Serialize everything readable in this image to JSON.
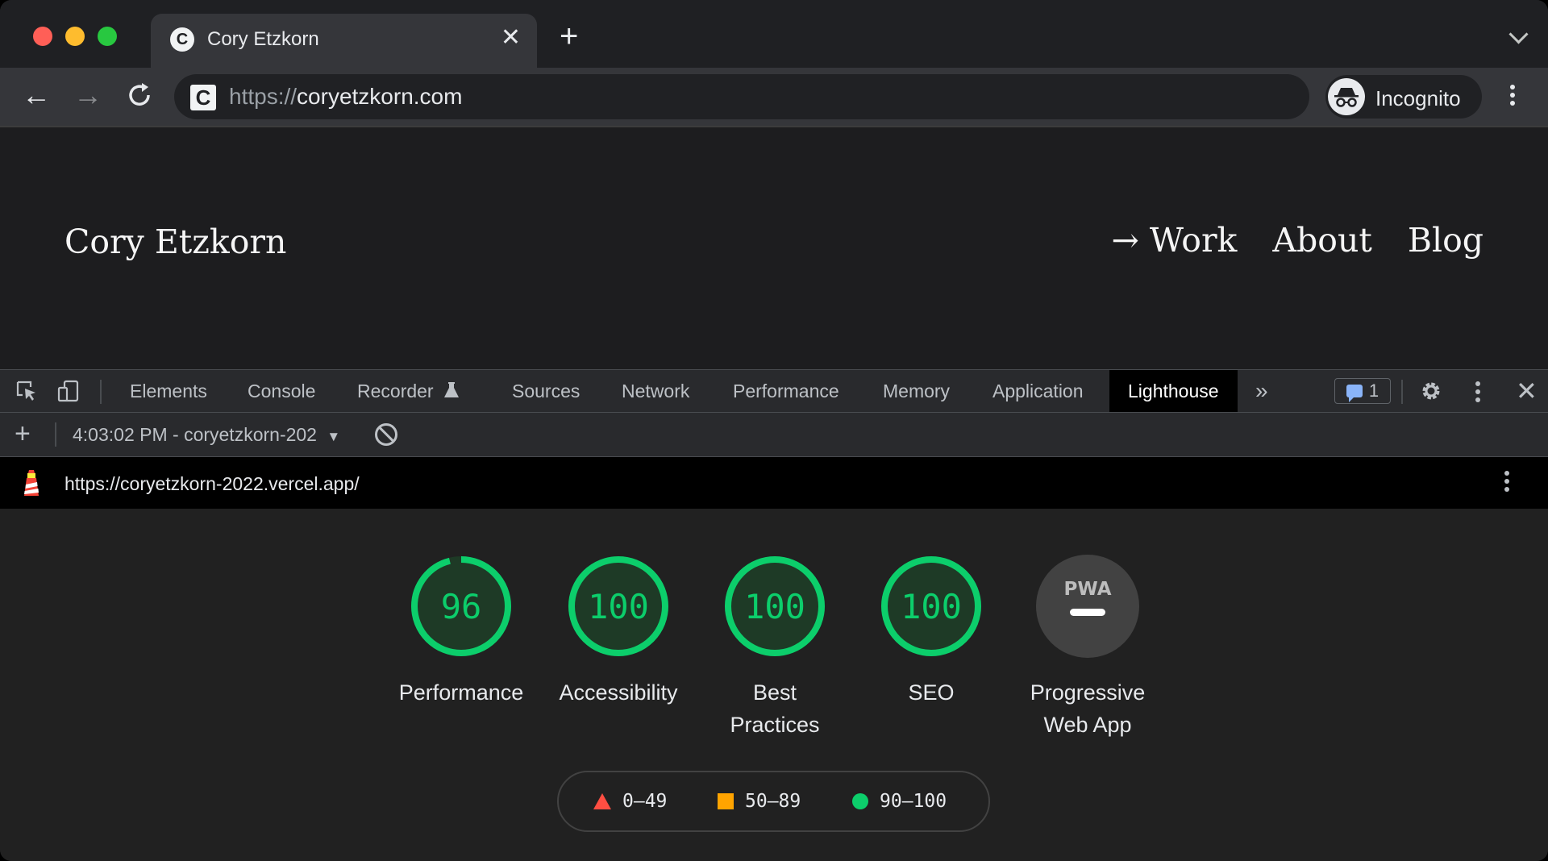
{
  "colors": {
    "pass": "#0cce6b",
    "pass_text": "#0cce6b",
    "average": "#ffa400",
    "fail": "#ff4e42",
    "gauge_bg": "#1e3a26"
  },
  "browser": {
    "tab": {
      "title": "Cory Etzkorn",
      "favicon": "C"
    },
    "address": {
      "scheme": "https://",
      "host": "coryetzkorn.com"
    },
    "incognito_label": "Incognito"
  },
  "page": {
    "site_title": "Cory Etzkorn",
    "nav": {
      "work": "→ Work",
      "about": "About",
      "blog": "Blog"
    }
  },
  "devtools": {
    "tabs": [
      {
        "label": "Elements"
      },
      {
        "label": "Console"
      },
      {
        "label": "Recorder"
      },
      {
        "label": "Sources"
      },
      {
        "label": "Network"
      },
      {
        "label": "Performance"
      },
      {
        "label": "Memory"
      },
      {
        "label": "Application"
      },
      {
        "label": "Lighthouse"
      }
    ],
    "issues_count": "1",
    "report_select": "4:03:02 PM - coryetzkorn-202",
    "report_url": "https://coryetzkorn-2022.vercel.app/"
  },
  "lighthouse": {
    "categories": [
      {
        "label": "Performance",
        "score": "96",
        "value": 96
      },
      {
        "label": "Accessibility",
        "score": "100",
        "value": 100
      },
      {
        "label": "Best\nPractices",
        "score": "100",
        "value": 100
      },
      {
        "label": "SEO",
        "score": "100",
        "value": 100
      }
    ],
    "pwa": {
      "label": "Progressive\nWeb App",
      "badge": "PWA"
    },
    "legend": {
      "fail": "0–49",
      "average": "50–89",
      "pass": "90–100"
    }
  }
}
